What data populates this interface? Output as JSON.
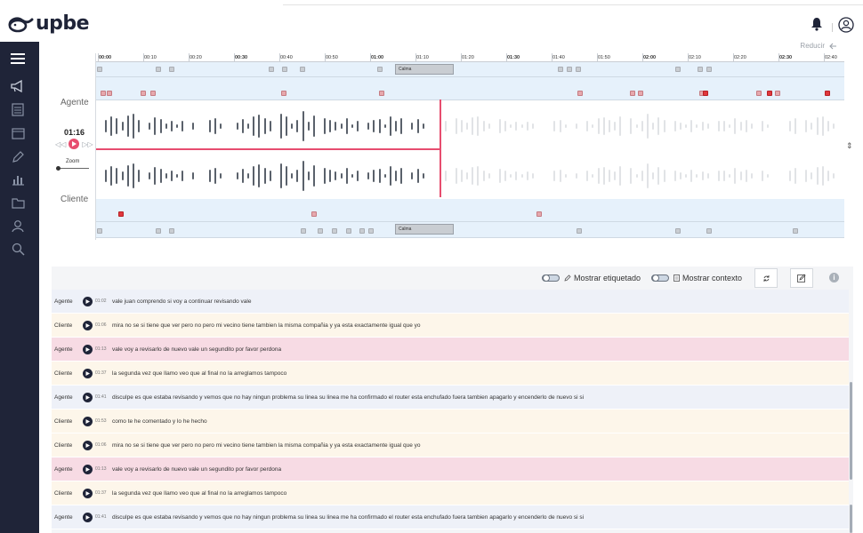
{
  "app": {
    "logo_text": "upbe"
  },
  "waveform": {
    "reducir_label": "Reducir",
    "agent_label": "Agente",
    "client_label": "Cliente",
    "current_time": "01:16",
    "zoom_label": "Zoom",
    "ruler_ticks": [
      "00:00",
      "00:10",
      "00:20",
      "00:30",
      "00:40",
      "00:50",
      "01:00",
      "01:10",
      "01:20",
      "01:30",
      "01:40",
      "01:50",
      "02:00",
      "02:10",
      "02:20",
      "02:30",
      "02:40"
    ],
    "bold_ticks": [
      "00:00",
      "00:30",
      "01:00",
      "01:30",
      "02:00",
      "02:30"
    ],
    "emotion_label_top": "Calma",
    "emotion_label_bottom": "Calma"
  },
  "toolbar": {
    "show_tagged_label": "Mostrar etiquetado",
    "show_context_label": "Mostrar contexto"
  },
  "transcript": [
    {
      "speaker": "Agente",
      "time": "01:02",
      "text": "vale juan comprendo si voy a continuar revisando vale",
      "style": "agente"
    },
    {
      "speaker": "Cliente",
      "time": "01:06",
      "text": "mira no se si tiene que ver pero no pero mi vecino tiene tambien la misma compañia y ya esta exactamente igual que yo",
      "style": "cliente"
    },
    {
      "speaker": "Agente",
      "time": "01:13",
      "text": "vale voy a revisarlo de nuevo vale un segundito por favor perdona",
      "style": "pink"
    },
    {
      "speaker": "Cliente",
      "time": "01:37",
      "text": "la segunda vez que llamo veo que al final no la arreglamos tampoco",
      "style": "cliente"
    },
    {
      "speaker": "Agente",
      "time": "01:41",
      "text": "disculpe es que estaba revisando y vemos que no hay ningun problema su linea su linea me ha confirmado el router esta enchufado fuera tambien apagarlo y encenderlo de nuevo si si",
      "style": "agente"
    },
    {
      "speaker": "Cliente",
      "time": "01:53",
      "text": "como te he comentado y lo he hecho",
      "style": "cliente"
    },
    {
      "speaker": "Cliente",
      "time": "01:06",
      "text": "mira no se si tiene que ver pero no pero mi vecino tiene tambien la misma compañia y ya esta exactamente igual que yo",
      "style": "cliente"
    },
    {
      "speaker": "Agente",
      "time": "01:13",
      "text": "vale voy a revisarlo de nuevo vale un segundito por favor perdona",
      "style": "pink"
    },
    {
      "speaker": "Cliente",
      "time": "01:37",
      "text": "la segunda vez que llamo veo que al final no la arreglamos tampoco",
      "style": "cliente"
    },
    {
      "speaker": "Agente",
      "time": "01:41",
      "text": "disculpe es que estaba revisando y vemos que no hay ningun problema su linea su linea me ha confirmado el router esta enchufado fuera tambien apagarlo y encenderlo de nuevo si si",
      "style": "agente"
    }
  ],
  "colors": {
    "sidebar": "#1f2438",
    "accent": "#e74d6f",
    "lane": "#e6f1fb"
  }
}
